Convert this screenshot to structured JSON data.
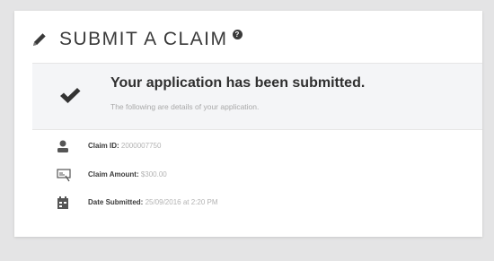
{
  "header": {
    "title": "SUBMIT A CLAIM",
    "help_glyph": "?"
  },
  "banner": {
    "title": "Your application has been submitted.",
    "subtitle": "The following are details of your application."
  },
  "details": [
    {
      "icon": "user-icon",
      "label": "Claim ID",
      "value": "2000007750"
    },
    {
      "icon": "receipt-icon",
      "label": "Claim Amount",
      "value": "$300.00"
    },
    {
      "icon": "calendar-icon",
      "label": "Date Submitted",
      "value": "25/09/2016 at 2:20 PM"
    }
  ],
  "colors": {
    "background": "#e4e4e5",
    "card": "#ffffff",
    "banner": "#f4f5f7",
    "text": "#333333"
  }
}
